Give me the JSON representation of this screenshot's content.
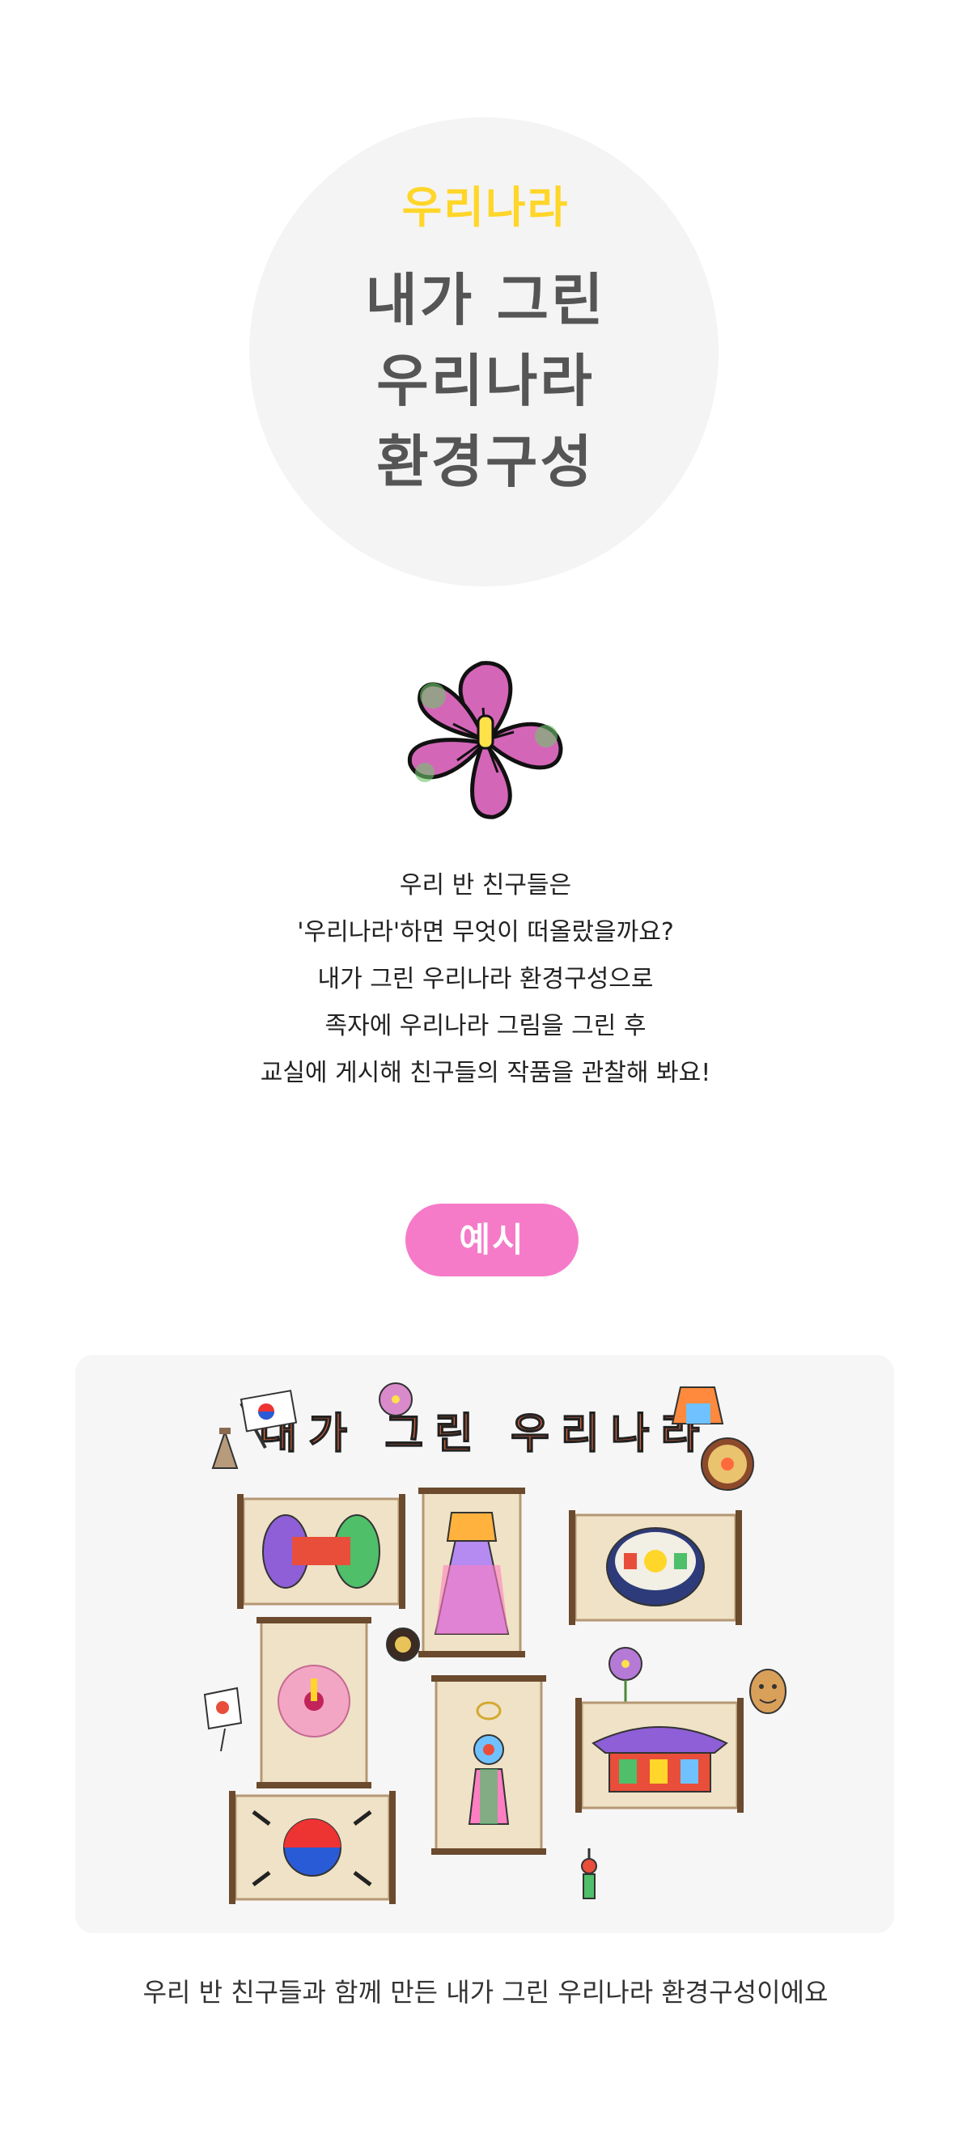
{
  "hero": {
    "subtitle": "우리나라",
    "title_lines": [
      "내가 그린",
      "우리나라",
      "환경구성"
    ]
  },
  "intro": {
    "lines": [
      "우리 반 친구들은",
      "'우리나라'하면 무엇이 떠올랐을까요?",
      "내가 그린 우리나라 환경구성으로",
      "족자에 우리나라 그림을 그린 후",
      "교실에 게시해 친구들의 작품을 관찰해 봐요!"
    ]
  },
  "badge": {
    "label": "예시"
  },
  "example": {
    "banner_title": "내가 그린 우리나라",
    "caption": "우리 반 친구들과 함께 만든 내가 그린 우리나라 환경구성이에요"
  },
  "colors": {
    "subtitle_yellow": "#ffd629",
    "badge_pink": "#f57bc8",
    "circle_gray": "#f4f4f4",
    "panel_gray": "#f6f6f6"
  },
  "icons": [
    "mugunghwa-flower-icon",
    "taegeukgi-flag-icon",
    "janggu-drum-icon",
    "hanbok-icon",
    "bibimbap-icon",
    "norigae-icon",
    "hanok-icon",
    "talmask-icon",
    "kite-icon",
    "cheomseongdae-icon"
  ]
}
